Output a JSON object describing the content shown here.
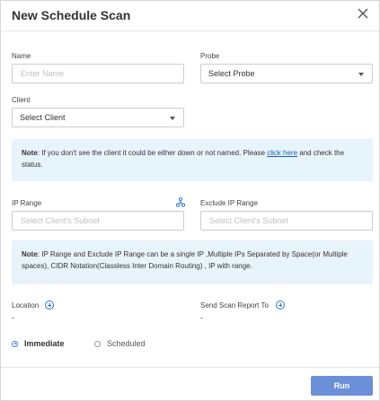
{
  "dialog": {
    "title": "New Schedule Scan"
  },
  "name": {
    "label": "Name",
    "placeholder": "Enter Name",
    "value": ""
  },
  "probe": {
    "label": "Probe",
    "selected": "Select Probe"
  },
  "client": {
    "label": "Client",
    "selected": "Select Client"
  },
  "note_client": {
    "bold": "Note",
    "text": ": If you don't see the client it could be either down or not named. Please ",
    "link": "click here",
    "suffix": " and check the status."
  },
  "ip_range": {
    "label": "IP Range",
    "placeholder": "Select Client's Subnet"
  },
  "exclude_ip_range": {
    "label": "Exclude IP Range",
    "placeholder": "Select Client's Subnet"
  },
  "note_ip": {
    "bold": "Note",
    "text": ": IP Range and Exclude IP Range can be a single IP ,Multiple IPs Separated by Space(or Multiple spaces), CIDR Notation(Classless Inter Domain Routing) , IP with range."
  },
  "location": {
    "label": "Location",
    "value": "-"
  },
  "send_report": {
    "label": "Send Scan Report To",
    "value": "-"
  },
  "schedule": {
    "options": [
      "Immediate",
      "Scheduled"
    ],
    "selected": "Immediate"
  },
  "actions": {
    "run_label": "Run"
  },
  "colors": {
    "accent": "#6b8fd8",
    "note_bg": "#e8f4fb",
    "link": "#1a5fb4"
  }
}
